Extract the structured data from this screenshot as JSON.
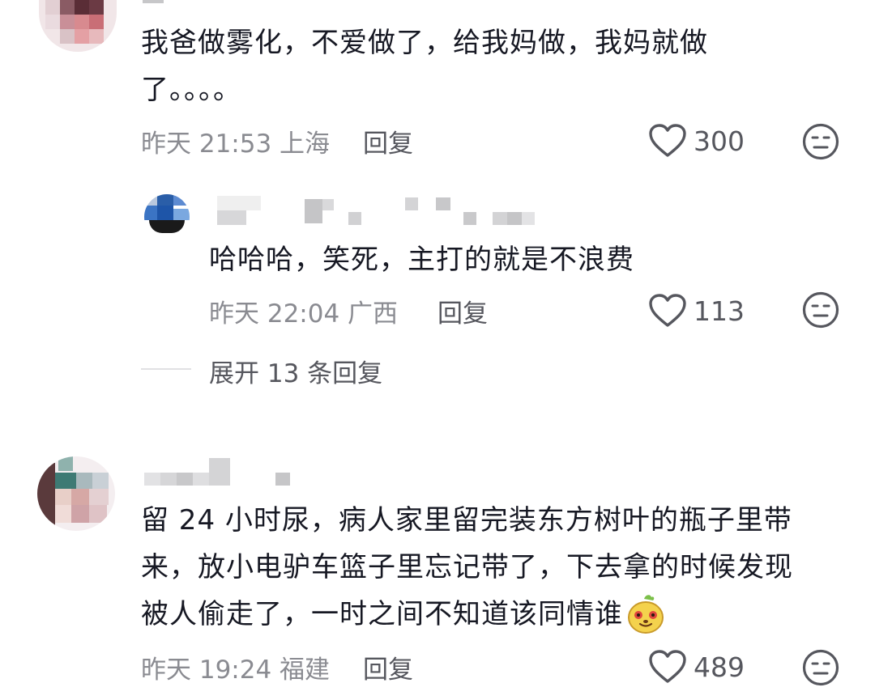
{
  "comments": [
    {
      "text_lines": [
        "我爸做雾化，不爱做了，给我妈做，我妈就做",
        "了。。。。"
      ],
      "meta": "昨天 21:53 上海",
      "reply_label": "回复",
      "likes": "300",
      "reply": {
        "text": "哈哈哈，笑死，主打的就是不浪费",
        "meta": "昨天 22:04 广西",
        "reply_label": "回复",
        "likes": "113"
      },
      "expand_label": "展开 13 条回复"
    },
    {
      "text_lines": [
        "留 24 小时尿，病人家里留完装东方树叶的瓶子里带",
        "来，放小电驴车篮子里忘记带了，下去拿的时候发现",
        "被人偷走了，一时之间不知道该同情谁"
      ],
      "meta": "昨天 19:24 福建",
      "reply_label": "回复",
      "likes": "489"
    }
  ],
  "colors": {
    "text": "#161823",
    "meta": "#8a8b91",
    "action": "#56575e"
  },
  "icons": {
    "like": "heart-outline-icon",
    "emoji": "neutral-face-icon",
    "inline_emoji": "yellow-cartoon-face-emoji"
  }
}
